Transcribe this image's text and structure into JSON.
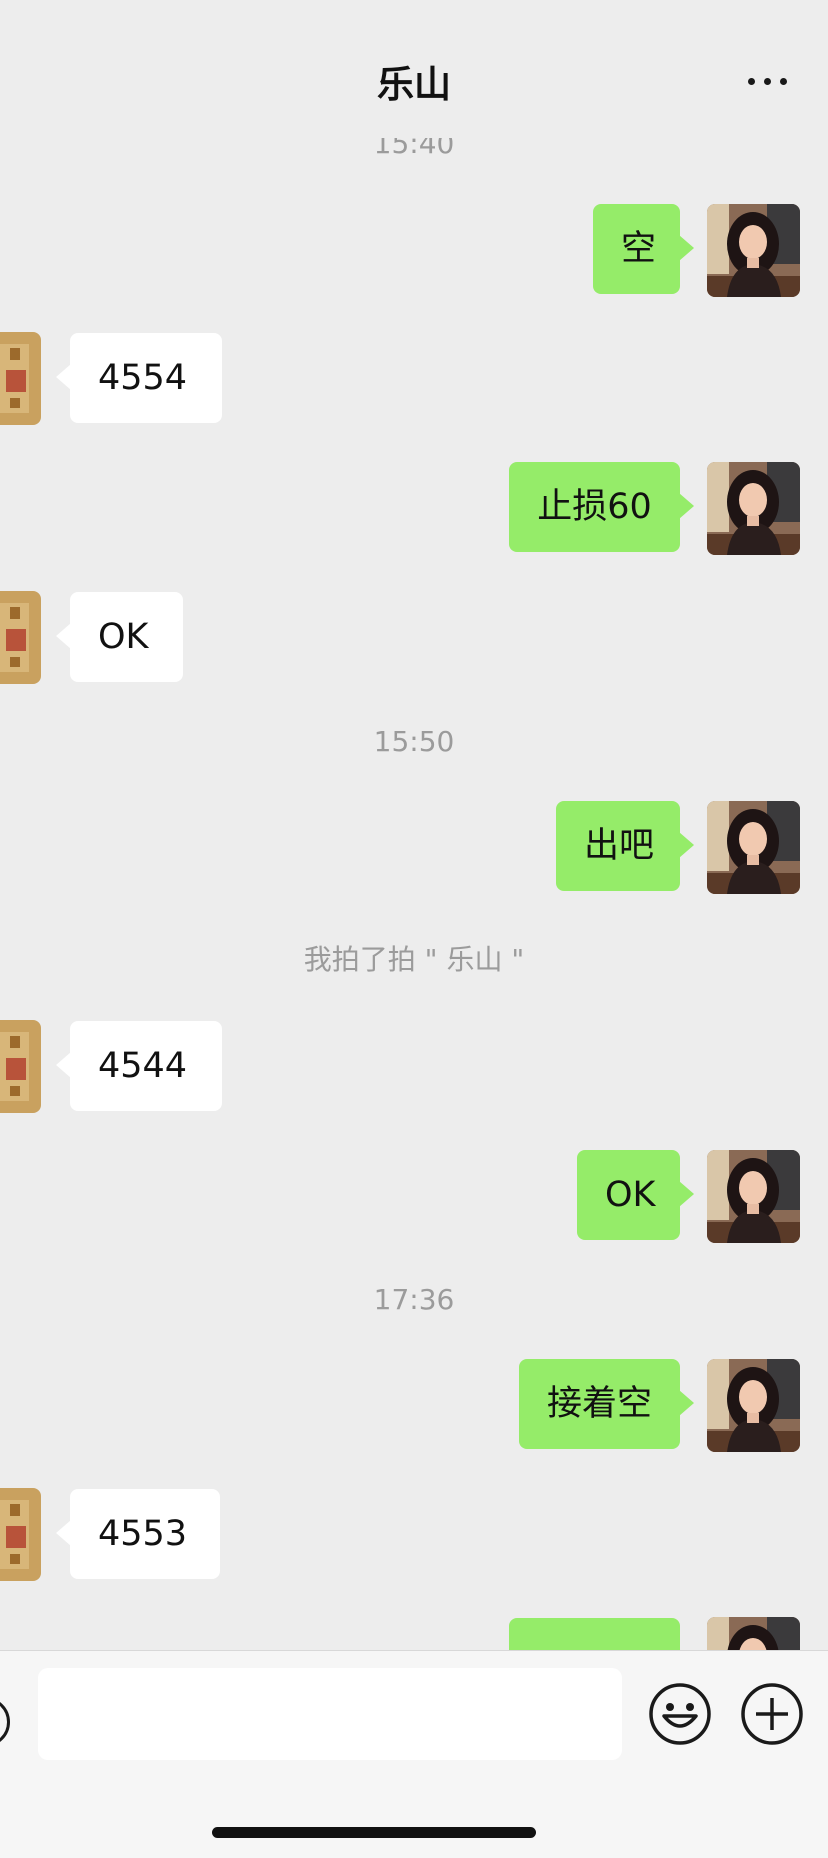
{
  "header": {
    "title": "乐山",
    "more_icon": "more-dots-icon"
  },
  "messages": {
    "t1": "15:40",
    "m1": "空",
    "m2": "4554",
    "m3": "止损60",
    "m4": "OK",
    "t2": "15:50",
    "m5": "出吧",
    "sys1": "我拍了拍 \" 乐山 \"",
    "m6": "4544",
    "m7": "OK",
    "t3": "17:36",
    "m8": "接着空",
    "m9": "4553"
  },
  "input": {
    "placeholder": "",
    "value": ""
  },
  "icons": {
    "voice": "voice-icon",
    "emoji": "emoji-icon",
    "plus": "plus-icon"
  },
  "colors": {
    "my_bubble": "#95ec69",
    "their_bubble": "#ffffff",
    "background": "#ededed"
  }
}
